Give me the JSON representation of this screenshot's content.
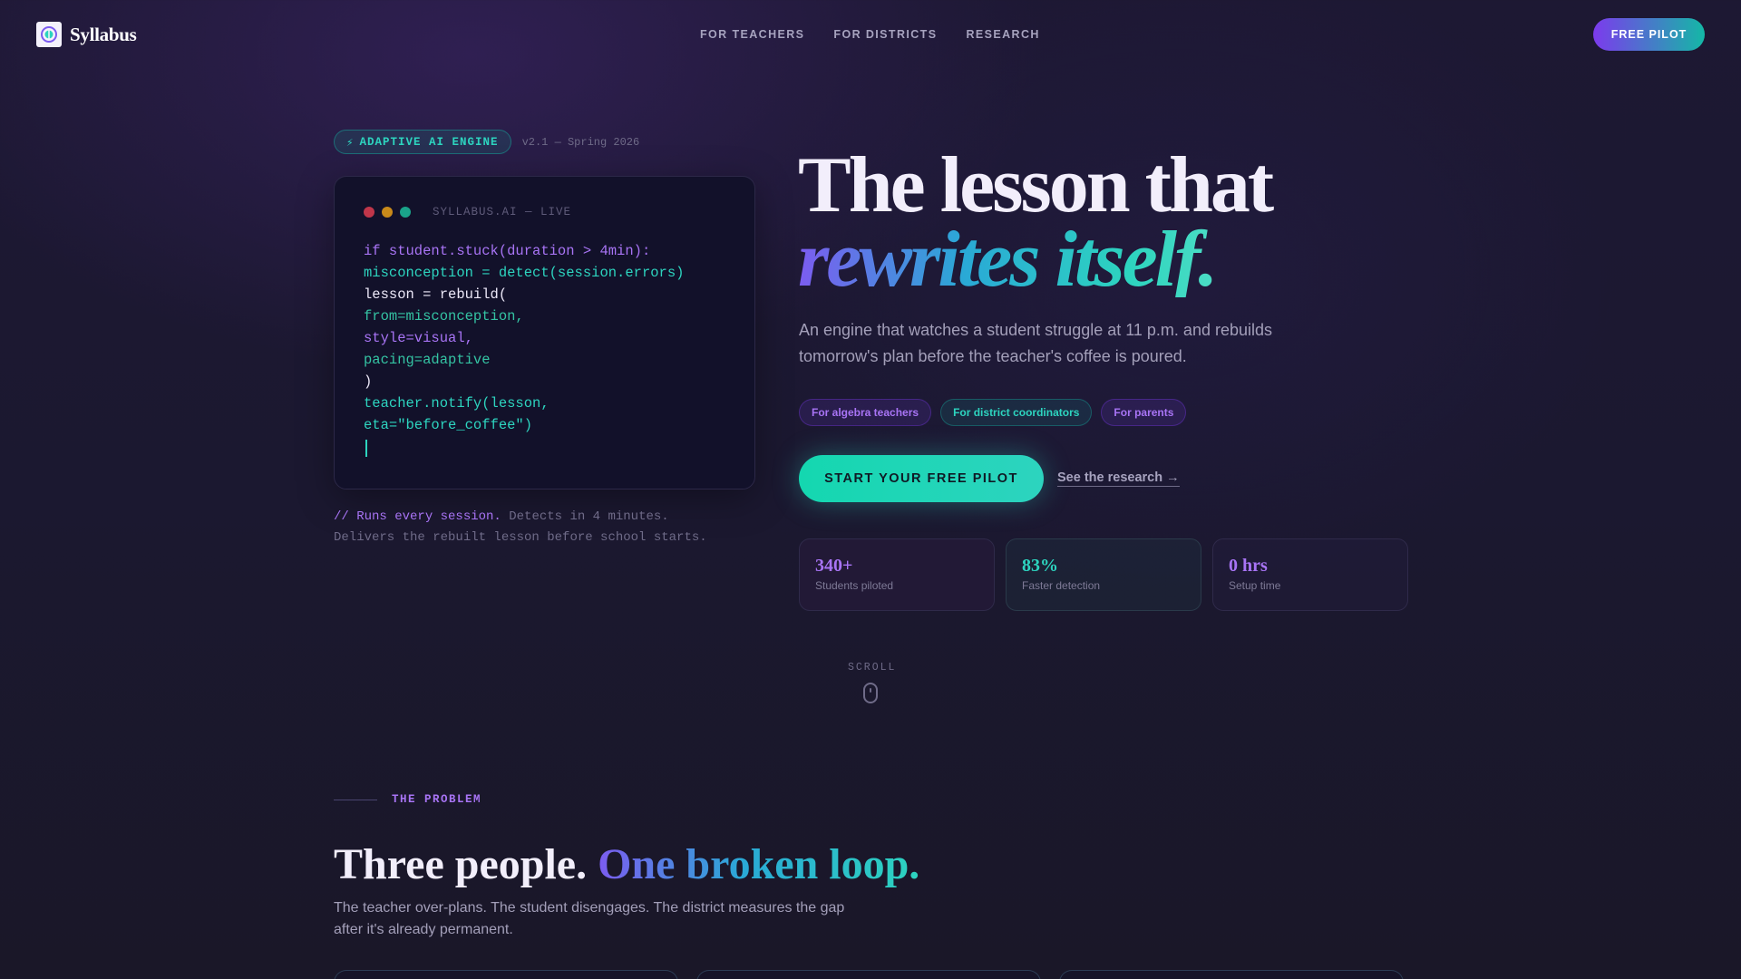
{
  "nav": {
    "brand": "Syllabus",
    "links": [
      "FOR TEACHERS",
      "FOR DISTRICTS",
      "RESEARCH"
    ],
    "cta": "FREE PILOT"
  },
  "hero": {
    "badge": "ADAPTIVE AI ENGINE",
    "badge_icon": "lightning-icon",
    "version": "v2.1 — Spring 2026",
    "code": {
      "title": "SYLLABUS.AI — LIVE",
      "lines": [
        "if student.stuck(duration > 4min):",
        "misconception = detect(session.errors)",
        "lesson = rebuild(",
        "from=misconception,",
        "style=visual,",
        "pacing=adaptive",
        ")",
        "teacher.notify(lesson,",
        "eta=\"before_coffee\")"
      ]
    },
    "caption_highlight": "// Runs every session.",
    "caption_rest_1": " Detects in 4 minutes.",
    "caption_line_2": "Delivers the rebuilt lesson before school starts.",
    "headline_line1": "The lesson that",
    "headline_line2": "rewrites itself.",
    "subhead": "An engine that watches a student struggle at 11 p.m. and rebuilds tomorrow's plan before the teacher's coffee is poured.",
    "chips": [
      "For algebra teachers",
      "For district coordinators",
      "For parents"
    ],
    "cta_primary": "START YOUR FREE PILOT",
    "cta_link": "See the research →",
    "stats": [
      {
        "value": "340+",
        "label": "Students piloted"
      },
      {
        "value": "83%",
        "label": "Faster detection"
      },
      {
        "value": "0 hrs",
        "label": "Setup time"
      }
    ],
    "scroll": "SCROLL"
  },
  "problem": {
    "eyebrow": "THE PROBLEM",
    "title_plain": "Three people.",
    "title_accent": "One broken loop.",
    "subtitle": "The teacher over-plans. The student disengages. The district measures the gap after it's already permanent."
  },
  "colors": {
    "accent_purple": "#7c3aed",
    "accent_teal": "#2dd4bf",
    "background": "#1b1830",
    "dot_red": "#c0364a",
    "dot_amber": "#c98a1a",
    "dot_green": "#1aa38a"
  }
}
